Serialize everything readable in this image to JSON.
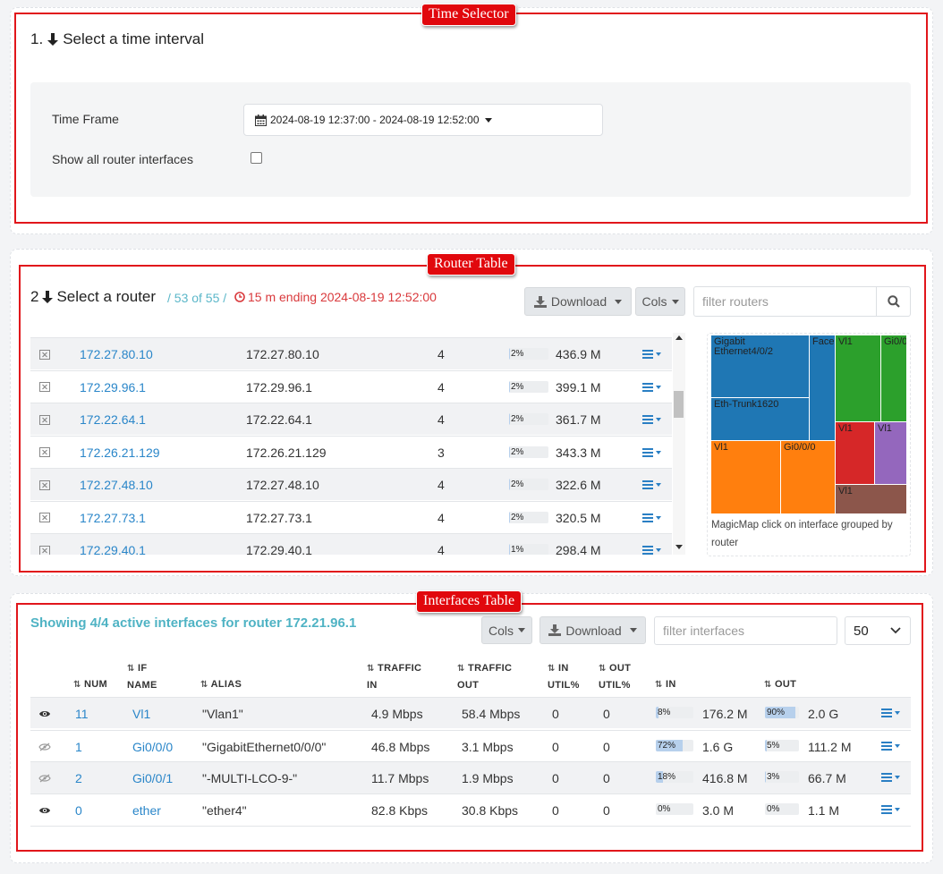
{
  "annotations": {
    "time_selector": "Time Selector",
    "router_table": "Router Table",
    "interfaces_table": "Interfaces Table"
  },
  "time_section": {
    "heading": "1. 🡫 Select a time interval",
    "heading_num": "1.",
    "heading_text": "Select a time interval",
    "time_frame_label": "Time Frame",
    "time_frame_value": "2024-08-19 12:37:00 - 2024-08-19 12:52:00",
    "show_all_label": "Show all router interfaces",
    "show_all_checked": false
  },
  "router_section": {
    "heading_num": "2",
    "heading_text": "Select a router",
    "count": "/ 53 of 55 /",
    "ending": "15 m ending 2024-08-19 12:52:00",
    "download_label": "Download",
    "cols_label": "Cols",
    "filter_placeholder": "filter routers",
    "rows": [
      {
        "name": "172.27.80.10",
        "ip": "172.27.80.10",
        "ifs": "4",
        "pct": "2%",
        "pct_val": 2,
        "traffic": "436.9 M"
      },
      {
        "name": "172.29.96.1",
        "ip": "172.29.96.1",
        "ifs": "4",
        "pct": "2%",
        "pct_val": 2,
        "traffic": "399.1 M"
      },
      {
        "name": "172.22.64.1",
        "ip": "172.22.64.1",
        "ifs": "4",
        "pct": "2%",
        "pct_val": 2,
        "traffic": "361.7 M"
      },
      {
        "name": "172.26.21.129",
        "ip": "172.26.21.129",
        "ifs": "3",
        "pct": "2%",
        "pct_val": 2,
        "traffic": "343.3 M"
      },
      {
        "name": "172.27.48.10",
        "ip": "172.27.48.10",
        "ifs": "4",
        "pct": "2%",
        "pct_val": 2,
        "traffic": "322.6 M"
      },
      {
        "name": "172.27.73.1",
        "ip": "172.27.73.1",
        "ifs": "4",
        "pct": "2%",
        "pct_val": 2,
        "traffic": "320.5 M"
      },
      {
        "name": "172.29.40.1",
        "ip": "172.29.40.1",
        "ifs": "4",
        "pct": "1%",
        "pct_val": 1,
        "traffic": "298.4 M"
      }
    ],
    "treemap": {
      "caption": "MagicMap click on interface grouped by router",
      "tiles": [
        {
          "label": "Gigabit Ethernet4/0/2",
          "color": "#1f77b4"
        },
        {
          "label": "Eth-Trunk1620",
          "color": "#1f77b4"
        },
        {
          "label": "Facel",
          "color": "#1f77b4"
        },
        {
          "label": "Vl1",
          "color": "#2ca02c"
        },
        {
          "label": "Gi0/0",
          "color": "#2ca02c"
        },
        {
          "label": "Vl1",
          "color": "#ff7f0e"
        },
        {
          "label": "Gi0/0/0",
          "color": "#ff7f0e"
        },
        {
          "label": "Vl1",
          "color": "#d62728"
        },
        {
          "label": "Vl1",
          "color": "#9467bd"
        },
        {
          "label": "Vl1",
          "color": "#8c564b"
        }
      ]
    }
  },
  "interfaces_section": {
    "heading": "Showing 4/4 active interfaces for router 172.21.96.1",
    "cols_label": "Cols",
    "download_label": "Download",
    "filter_placeholder": "filter interfaces",
    "page_size": "50",
    "headers": {
      "num": "NUM",
      "if_name_1": "IF",
      "if_name_2": "NAME",
      "alias": "ALIAS",
      "traffic_in_1": "TRAFFIC",
      "traffic_in_2": "IN",
      "traffic_out_1": "TRAFFIC",
      "traffic_out_2": "OUT",
      "in_util_1": "IN",
      "in_util_2": "UTIL%",
      "out_util_1": "OUT",
      "out_util_2": "UTIL%",
      "in": "IN",
      "out": "OUT"
    },
    "rows": [
      {
        "visible": true,
        "num": "11",
        "name": "Vl1",
        "alias": "\"Vlan1\"",
        "tin": "4.9 Mbps",
        "tout": "58.4 Mbps",
        "inu": "0",
        "outu": "0",
        "inpct": "8%",
        "inpct_val": 8,
        "in": "176.2 M",
        "outpct": "90%",
        "outpct_val": 90,
        "out": "2.0 G"
      },
      {
        "visible": false,
        "num": "1",
        "name": "Gi0/0/0",
        "alias": "\"GigabitEthernet0/0/0\"",
        "tin": "46.8 Mbps",
        "tout": "3.1 Mbps",
        "inu": "0",
        "outu": "0",
        "inpct": "72%",
        "inpct_val": 72,
        "in": "1.6 G",
        "outpct": "5%",
        "outpct_val": 5,
        "out": "111.2 M"
      },
      {
        "visible": false,
        "num": "2",
        "name": "Gi0/0/1",
        "alias": "\"-MULTI-LCO-9-\"",
        "tin": "11.7 Mbps",
        "tout": "1.9 Mbps",
        "inu": "0",
        "outu": "0",
        "inpct": "18%",
        "inpct_val": 18,
        "in": "416.8 M",
        "outpct": "3%",
        "outpct_val": 3,
        "out": "66.7 M"
      },
      {
        "visible": true,
        "num": "0",
        "name": "ether",
        "alias": "\"ether4\"",
        "tin": "82.8 Kbps",
        "tout": "30.8 Kbps",
        "inu": "0",
        "outu": "0",
        "inpct": "0%",
        "inpct_val": 0,
        "in": "3.0 M",
        "outpct": "0%",
        "outpct_val": 0,
        "out": "1.1 M"
      }
    ]
  }
}
